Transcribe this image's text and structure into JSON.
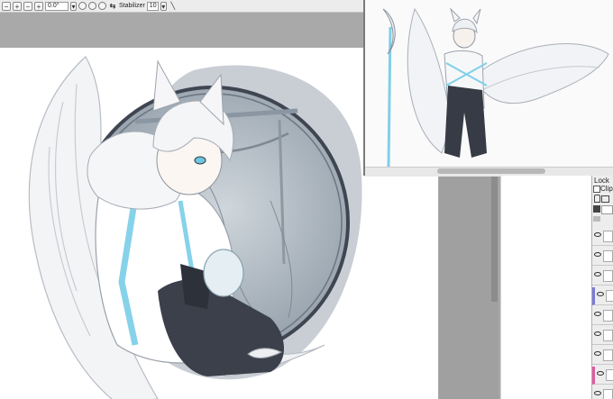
{
  "toolbar": {
    "angle_value": "0.0°",
    "stabilizer_label": "Stabilizer",
    "stabilizer_value": "10"
  },
  "layer_panel": {
    "lock_label": "Lock",
    "clip_label": "Clipp",
    "accent_colors": [
      "#7b7bd8",
      "#e05aa0"
    ]
  },
  "illustration": {
    "subject": "white-haired winged character in circular frame",
    "palette": [
      "#ffffff",
      "#cfe6f2",
      "#7fd0ea",
      "#8a96a4",
      "#3a3f4a"
    ]
  }
}
